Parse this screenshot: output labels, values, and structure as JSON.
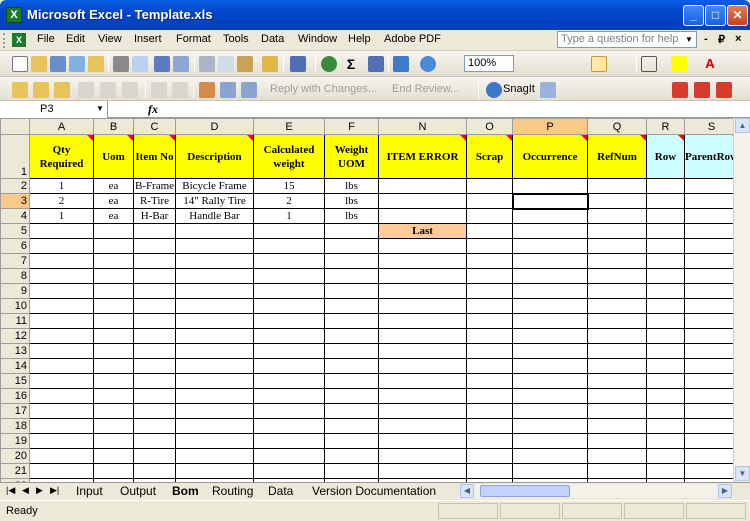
{
  "window": {
    "title": "Microsoft Excel - Template.xls",
    "app_icon": "excel-icon",
    "controls": [
      "_",
      "□",
      "✕"
    ]
  },
  "menu": {
    "items": [
      "File",
      "Edit",
      "View",
      "Insert",
      "Format",
      "Tools",
      "Data",
      "Window",
      "Help",
      "Adobe PDF"
    ],
    "ask_placeholder": "Type a question for help",
    "window_controls": [
      "-",
      "₽",
      "×"
    ]
  },
  "toolbar": {
    "zoom": "100%",
    "reply_label": "Reply with Changes...",
    "end_review_label": "End Review...",
    "snagit_label": "SnagIt"
  },
  "formula_bar": {
    "name_box": "P3",
    "fx_label": "fx",
    "formula": ""
  },
  "sheet": {
    "columns": [
      "A",
      "B",
      "C",
      "D",
      "E",
      "F",
      "N",
      "O",
      "P",
      "Q",
      "R",
      "S"
    ],
    "selected_column": "P",
    "selected_row": 3,
    "headers": [
      "Qty Required",
      "Uom",
      "Item No",
      "Description",
      "Calculated weight",
      "Weight UOM",
      "ITEM ERROR",
      "Scrap",
      "Occurrence",
      "RefNum",
      "Row",
      "ParentRow"
    ],
    "rows": [
      [
        "1",
        "ea",
        "B-Frame",
        "Bicycle Frame",
        "15",
        "lbs",
        "",
        "",
        "",
        "",
        "",
        ""
      ],
      [
        "2",
        "ea",
        "R-Tire",
        "14\" Rally Tire",
        "2",
        "lbs",
        "",
        "",
        "",
        "",
        "",
        ""
      ],
      [
        "1",
        "ea",
        "H-Bar",
        "Handle Bar",
        "1",
        "lbs",
        "",
        "",
        "",
        "",
        "",
        ""
      ],
      [
        "",
        "",
        "",
        "",
        "",
        "",
        "Last",
        "",
        "",
        "",
        "",
        ""
      ]
    ],
    "total_rows": 22
  },
  "tabs": {
    "sheets": [
      "Input",
      "Output",
      "Bom",
      "Routing",
      "Data",
      "Version Documentation"
    ],
    "active": "Bom"
  },
  "status": {
    "text": "Ready"
  },
  "colors": {
    "header_yellow": "#ffff00",
    "header_cyan": "#ccffff",
    "last_orange": "#ffcc99",
    "selection_orange": "#f8c98b",
    "title_blue": "#0447c9"
  }
}
